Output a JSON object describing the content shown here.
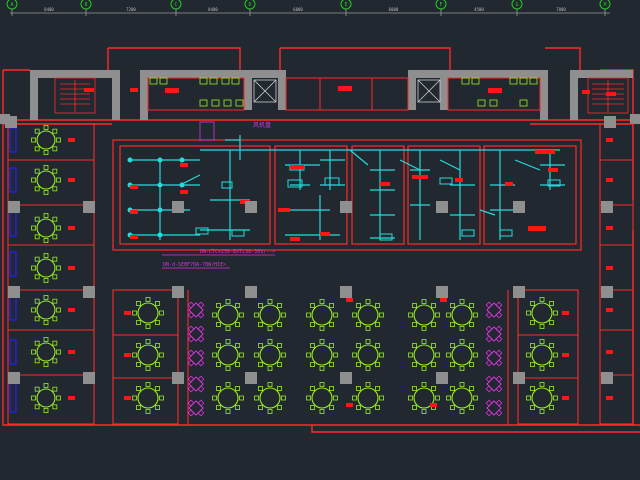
{
  "grid_axes": [
    {
      "label": "A",
      "color": "#22cc22"
    },
    {
      "label": "B",
      "color": "#22cc22"
    },
    {
      "label": "C",
      "color": "#22cc22"
    },
    {
      "label": "D",
      "color": "#22cc22"
    },
    {
      "label": "E",
      "color": "#22cc22"
    },
    {
      "label": "F",
      "color": "#22cc22"
    },
    {
      "label": "G",
      "color": "#22cc22"
    },
    {
      "label": "H",
      "color": "#22cc22"
    }
  ],
  "dimensions": [
    "8400",
    "7200",
    "8400",
    "6000",
    "6000",
    "4500",
    "7800"
  ],
  "annotations": {
    "tag_top": "风机盘",
    "pipe_label_1": "DN-CTCV250-BXTL38-36V/-->",
    "pipe_label_2": "DN-d-SEBF70A-78W/HIE>"
  },
  "colors": {
    "background": "#212830",
    "wall": "#ff2a2a",
    "column": "#8f8f8f",
    "round_table": "#99ee22",
    "square_table": "#dd33dd",
    "hvac_duct": "#22dddd",
    "equipment_red": "#ff1515",
    "grid_bubble": "#22cc22",
    "window_blue": "#2222ff"
  },
  "layers": [
    "walls",
    "columns",
    "hvac-ducts",
    "dining-tables",
    "stairs",
    "elevators",
    "toilets"
  ]
}
